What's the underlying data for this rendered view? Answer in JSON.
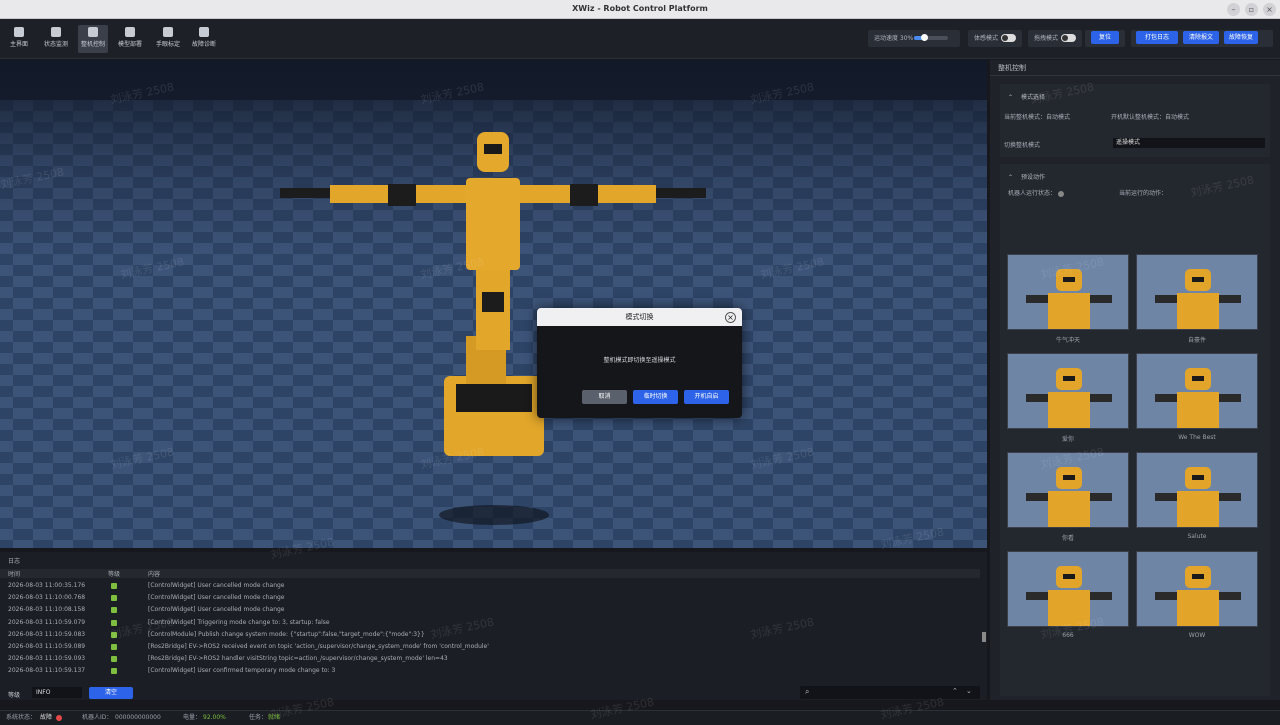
{
  "window": {
    "title": "XWiz - Robot Control Platform"
  },
  "toolbar": {
    "nav": [
      {
        "label": "主界面",
        "icon": "home-icon"
      },
      {
        "label": "状态监测",
        "icon": "monitor-icon"
      },
      {
        "label": "整机控制",
        "icon": "control-icon"
      },
      {
        "label": "模型部署",
        "icon": "rocket-icon"
      },
      {
        "label": "手眼标定",
        "icon": "calibrate-icon"
      },
      {
        "label": "故障诊断",
        "icon": "diagnose-icon"
      }
    ],
    "speed_label": "运动速度 30%",
    "speed_value": 0.3,
    "follow_mode_label": "体感模式",
    "drag_mode_label": "拖拽模式",
    "reset_button": "复位",
    "right_buttons": [
      "打包日志",
      "清除报文",
      "故障恢复"
    ]
  },
  "right_panel": {
    "title": "整机控制",
    "mode_section": {
      "header": "模式选择",
      "current_mode": "当前整机模式：自动模式",
      "default_mode": "开机默认整机模式：自动模式",
      "switch_label": "切换整机模式",
      "switch_value": "遥操模式"
    },
    "action_section": {
      "header": "预设动作",
      "run_status": "机器人运行状态：",
      "current_action": "当前运行的动作："
    },
    "actions": [
      "牛气冲天",
      "自豪件",
      "爱你",
      "We The Best",
      "你看",
      "Salute",
      "666",
      "WOW"
    ]
  },
  "dialog": {
    "title": "模式切换",
    "message": "整机模式即切换至遥操模式",
    "cancel": "取消",
    "temp_switch": "临时切换",
    "boot_switch": "开机自启"
  },
  "log": {
    "title": "日志",
    "columns": {
      "time": "时间",
      "level": "等级",
      "content": "内容"
    },
    "rows": [
      {
        "time": "2026-08-03 11:00:35.176",
        "content": "[ControlWidget] User cancelled mode change"
      },
      {
        "time": "2026-08-03 11:10:00.768",
        "content": "[ControlWidget] User cancelled mode change"
      },
      {
        "time": "2026-08-03 11:10:08.158",
        "content": "[ControlWidget] User cancelled mode change"
      },
      {
        "time": "2026-08-03 11:10:59.079",
        "content": "[ControlWidget] Triggering mode change to: 3, startup: false"
      },
      {
        "time": "2026-08-03 11:10:59.083",
        "content": "[ControlModule] Publish change system mode: {\"startup\":false,\"target_mode\":{\"mode\":3}}"
      },
      {
        "time": "2026-08-03 11:10:59.089",
        "content": "[Ros2Bridge] EV->ROS2 received event on topic 'action_/supervisor/change_system_mode' from 'control_module'"
      },
      {
        "time": "2026-08-03 11:10:59.093",
        "content": "[Ros2Bridge] EV->ROS2 handler visitString topic=action_/supervisor/change_system_mode' len=43"
      },
      {
        "time": "2026-08-03 11:10:59.137",
        "content": "[ControlWidget] User confirmed temporary mode change to: 3"
      }
    ],
    "level_label": "等级",
    "level_value": "INFO",
    "clear_button": "清空"
  },
  "statusbar": {
    "system_label": "系统状态：",
    "system_value": "故障",
    "robot_id_label": "机器人ID：",
    "robot_id_value": "000000000000",
    "battery_label": "电量：",
    "battery_value": "92.00%",
    "task_label": "任务：",
    "task_value": "就绪"
  },
  "watermark": "刘泳芳 2508",
  "colors": {
    "accent": "#2d63e8",
    "ok": "#7fbf3f",
    "error": "#e54848"
  }
}
